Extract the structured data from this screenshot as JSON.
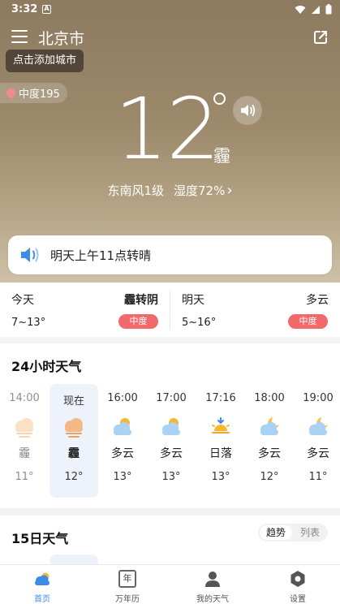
{
  "status_bar": {
    "time": "3:32",
    "notification_letter": "A"
  },
  "header": {
    "city": "北京市",
    "tooltip": "点击添加城市"
  },
  "aqi": {
    "label": "中度195"
  },
  "current": {
    "temperature": "12",
    "condition": "霾",
    "wind": "东南风1级",
    "humidity": "湿度72%",
    "chevron": "›"
  },
  "notice": {
    "text": "明天上午11点转晴"
  },
  "days": [
    {
      "label": "今天",
      "condition": "霾转阴",
      "range": "7~13°",
      "badge": "中度"
    },
    {
      "label": "明天",
      "condition": "多云",
      "range": "5~16°",
      "badge": "中度"
    }
  ],
  "hourly": {
    "title": "24小时天气",
    "items": [
      {
        "time": "14:00",
        "condition": "霾",
        "temp": "11°",
        "icon": "haze-icon"
      },
      {
        "time": "现在",
        "condition": "霾",
        "temp": "12°",
        "icon": "haze-icon"
      },
      {
        "time": "16:00",
        "condition": "多云",
        "temp": "13°",
        "icon": "partly-cloudy-icon"
      },
      {
        "time": "17:00",
        "condition": "多云",
        "temp": "13°",
        "icon": "partly-cloudy-icon"
      },
      {
        "time": "17:16",
        "condition": "日落",
        "temp": "13°",
        "icon": "sunset-icon"
      },
      {
        "time": "18:00",
        "condition": "多云",
        "temp": "12°",
        "icon": "cloudy-night-icon"
      },
      {
        "time": "19:00",
        "condition": "多云",
        "temp": "11°",
        "icon": "cloudy-night-icon"
      }
    ]
  },
  "fifteen_day": {
    "title": "15日天气",
    "toggle_trend": "趋势",
    "toggle_list": "列表"
  },
  "tabs": [
    {
      "label": "首页",
      "icon": "home-weather-icon",
      "active": true
    },
    {
      "label": "万年历",
      "icon": "calendar-icon",
      "active": false,
      "glyph": "年"
    },
    {
      "label": "我的天气",
      "icon": "person-icon",
      "active": false
    },
    {
      "label": "设置",
      "icon": "settings-icon",
      "active": false
    }
  ],
  "colors": {
    "accent": "#3c8ce8",
    "badge": "#f16969",
    "hero_top": "#8d7a5f"
  }
}
